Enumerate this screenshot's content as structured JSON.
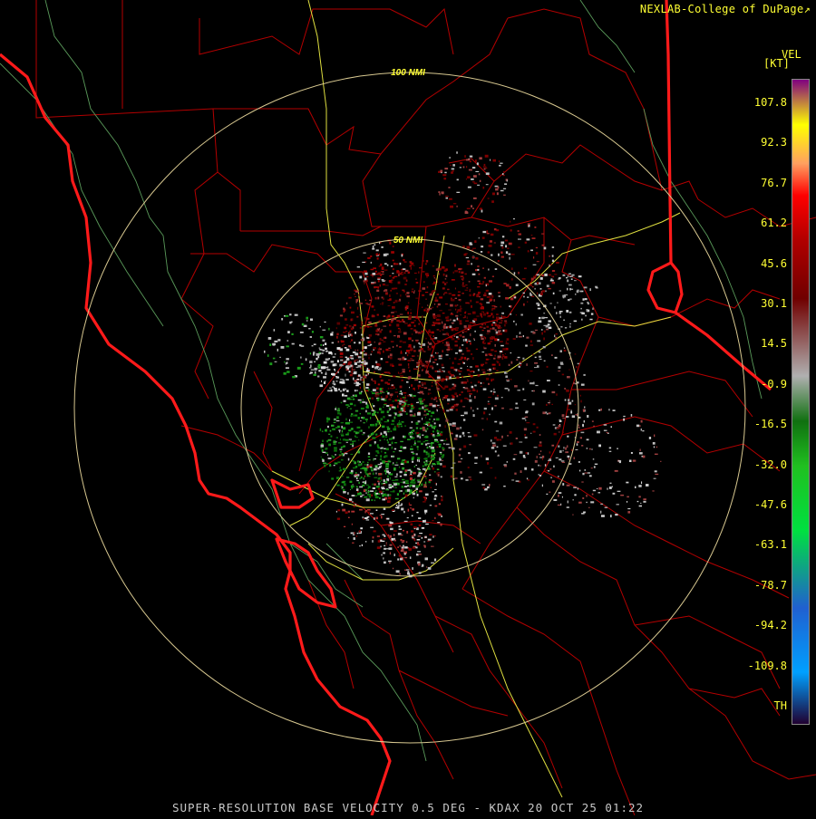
{
  "header": {
    "brand": "NEXLAB-College of DuPage",
    "brand_mark": "↗"
  },
  "map": {
    "range_rings": [
      {
        "label": "100 NMI"
      },
      {
        "label": "50 NMI"
      }
    ],
    "colors": {
      "background": "#000000",
      "state_border": "#ff0000",
      "county_border": "#b40000",
      "highway": "#e6e64a",
      "coastline_overlay": "#5a9a5a",
      "range_ring": "#d8c890",
      "inbound": "#1a9a1a",
      "outbound": "#8a0000"
    }
  },
  "legend": {
    "title": "VEL",
    "units": "[KT]",
    "ticks": [
      "107.8",
      "92.3",
      "76.7",
      "61.2",
      "45.6",
      "30.1",
      "14.5",
      "-0.9",
      "-16.5",
      "-32.0",
      "-47.6",
      "-63.1",
      "-78.7",
      "-94.2",
      "-109.8",
      "TH"
    ],
    "colors": [
      "#800080",
      "#ffff00",
      "#ffa060",
      "#ff0000",
      "#b00000",
      "#700000",
      "#b0b0b0",
      "#107010",
      "#20c020",
      "#00e040",
      "#2060d0",
      "#00a0ff",
      "#200030"
    ]
  },
  "footer": {
    "product": "SUPER-RESOLUTION BASE VELOCITY 0.5 DEG - KDAX 20 OCT 25 01:22"
  }
}
